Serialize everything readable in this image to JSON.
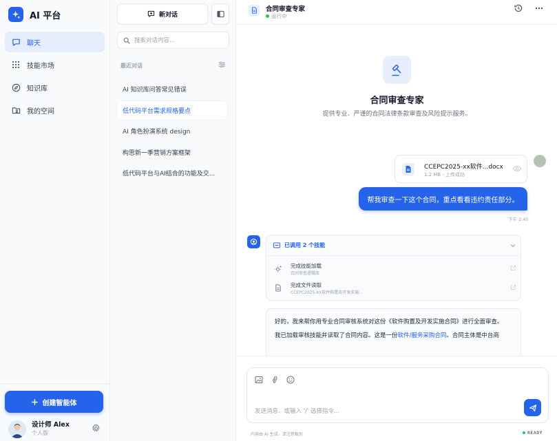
{
  "app": {
    "brand_name": "AI 平台"
  },
  "nav": {
    "items": [
      {
        "label": "聊天",
        "icon": "chat-bubble-icon",
        "active": true
      },
      {
        "label": "技能市场",
        "icon": "grid-dots-icon",
        "active": false
      },
      {
        "label": "知识库",
        "icon": "compass-icon",
        "active": false
      },
      {
        "label": "我的空间",
        "icon": "folder-user-icon",
        "active": false
      }
    ],
    "create_label": "创建智能体"
  },
  "user": {
    "name": "设计师 Alex",
    "plan": "个人版"
  },
  "conversations": {
    "new_chat_label": "新对话",
    "search_placeholder": "搜索对话内容...",
    "section_label": "最近对话",
    "items": [
      {
        "title": "AI 知识库问答常见错误",
        "active": false
      },
      {
        "title": "低代码平台需求规格要点",
        "active": true
      },
      {
        "title": "AI 角色扮演系统 design",
        "active": false
      },
      {
        "title": "构思新一季营销方案框架",
        "active": false
      },
      {
        "title": "低代码平台与AI结合的功能及交...",
        "active": false
      }
    ]
  },
  "chat": {
    "title": "合同审查专家",
    "status": "运行中",
    "hero_title": "合同审查专家",
    "hero_desc": "提供专业、严谨的合同法律条款审查及风险提示服务。",
    "file": {
      "name": "CCEPC2025-xx软件...docx",
      "meta": "1.2 MB · 上传成功"
    },
    "user_message": "帮我审查一下这个合同，重点看看违约责任部分。",
    "user_time": "下午 2:45",
    "skills_header": "已调用 2 个技能",
    "skills": [
      {
        "title": "完成技能加载",
        "subtitle": "合同审查逻辑库",
        "icon": "gear-sparkle-icon"
      },
      {
        "title": "完成文件读取",
        "subtitle": "CCEPC2025-XX软件购置及开发实施...",
        "icon": "document-icon"
      }
    ],
    "answer_p1": "好的，我来帮你用专业合同审核系统对这份《软件购置及开发实施合同》进行全面审查。",
    "answer_p2_prefix": "我已加载审核技能并读取了合同内容。这是一份",
    "answer_p2_link": "软件/服务采购合同",
    "answer_p2_suffix": "。合同主体是中台商",
    "composer_placeholder": "发送消息、或输入 '/' 选择指令...",
    "disclaimer": "内容由 AI 生成，请注意甄别",
    "ready_label": "READY"
  },
  "colors": {
    "accent": "#2563eb",
    "status_green": "#22c55e",
    "active_bg": "#e5edfd"
  }
}
